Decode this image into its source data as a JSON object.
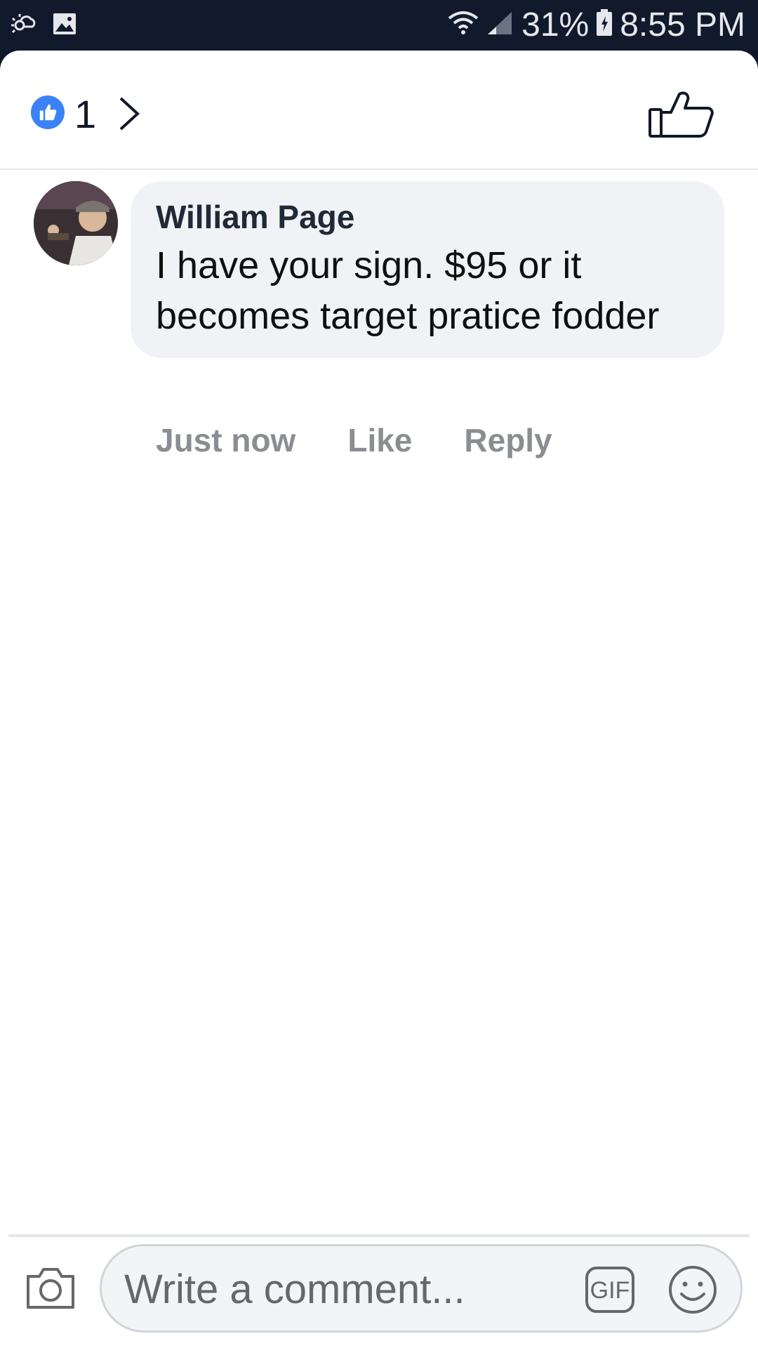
{
  "status_bar": {
    "battery": "31%",
    "time": "8:55 PM",
    "icons": [
      "weather-icon",
      "image-icon",
      "wifi-icon",
      "signal-icon",
      "battery-icon"
    ]
  },
  "header": {
    "like_count": "1",
    "icons": [
      "like-badge-icon",
      "chevron-right-icon",
      "like-outline-icon"
    ]
  },
  "comment": {
    "author": "William Page",
    "text": "I have your sign.  $95 or it becomes target pratice fodder",
    "time": "Just now",
    "like_label": "Like",
    "reply_label": "Reply"
  },
  "composer": {
    "placeholder": "Write a comment...",
    "gif_label": "GIF",
    "icons": [
      "camera-icon",
      "gif-icon",
      "emoji-icon"
    ]
  },
  "colors": {
    "status_bg": "#111a2c",
    "accent_blue": "#3b82f6",
    "bubble_bg": "#f0f2f5",
    "meta_gray": "#8a8d91"
  }
}
